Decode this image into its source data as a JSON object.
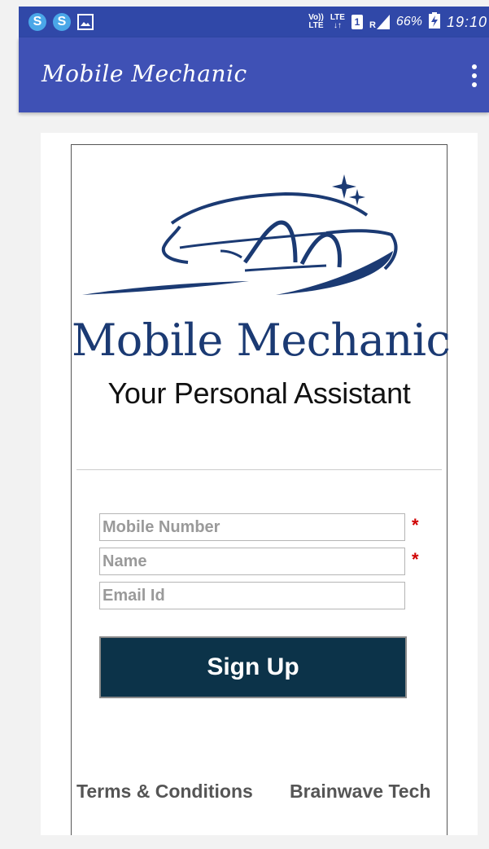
{
  "status_bar": {
    "volte_line1": "Vo))",
    "volte_line2": "LTE",
    "network_line1": "LTE",
    "network_line2": "↓↑",
    "sim_slot": "1",
    "roaming": "R",
    "battery_percent": "66%",
    "time": "19:10"
  },
  "app_bar": {
    "title": "Mobile Mechanic"
  },
  "logo": {
    "title": "Mobile Mechanic",
    "subtitle": "Your Personal Assistant"
  },
  "form": {
    "mobile_placeholder": "Mobile Number",
    "name_placeholder": "Name",
    "email_placeholder": "Email Id",
    "required_mark": "*",
    "signup_label": "Sign Up"
  },
  "footer": {
    "terms": "Terms & Conditions",
    "brand": "Brainwave Tech"
  },
  "colors": {
    "app_bar": "#3f51b5",
    "status_bar": "#3048a8",
    "button": "#0c3349",
    "logo_blue": "#1b3a73",
    "required": "#d00000"
  }
}
